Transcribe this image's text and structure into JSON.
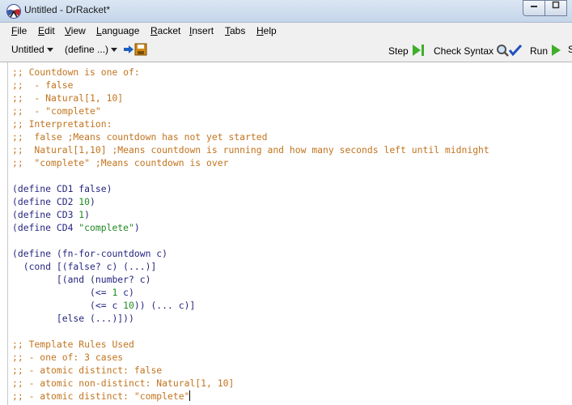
{
  "window": {
    "title": "Untitled - DrRacket*"
  },
  "menu": [
    "File",
    "Edit",
    "View",
    "Language",
    "Racket",
    "Insert",
    "Tabs",
    "Help"
  ],
  "toolbar": {
    "file_label": "Untitled",
    "define_label": "(define ...)",
    "step_label": "Step",
    "check_syntax_label": "Check Syntax",
    "run_label": "Run",
    "stop_label": "S"
  },
  "colors": {
    "comment": "#c2741f",
    "paren": "#262680",
    "literal": "#228b22"
  },
  "code_lines": [
    [
      {
        "t": ";; Countdown is one of:",
        "c": "cm"
      }
    ],
    [
      {
        "t": ";;  - false",
        "c": "cm"
      }
    ],
    [
      {
        "t": ";;  - Natural[1, 10]",
        "c": "cm"
      }
    ],
    [
      {
        "t": ";;  - \"complete\"",
        "c": "cm"
      }
    ],
    [
      {
        "t": ";; Interpretation:",
        "c": "cm"
      }
    ],
    [
      {
        "t": ";;  false ;Means countdown has not yet started",
        "c": "cm"
      }
    ],
    [
      {
        "t": ";;  Natural[1,10] ;Means countdown is running and how many seconds left until midnight",
        "c": "cm"
      }
    ],
    [
      {
        "t": ";;  \"complete\" ;Means countdown is over",
        "c": "cm"
      }
    ],
    [],
    [
      {
        "t": "(define CD1 false)",
        "c": "kw"
      }
    ],
    [
      {
        "t": "(define CD2 ",
        "c": "kw"
      },
      {
        "t": "10",
        "c": "num"
      },
      {
        "t": ")",
        "c": "kw"
      }
    ],
    [
      {
        "t": "(define CD3 ",
        "c": "kw"
      },
      {
        "t": "1",
        "c": "num"
      },
      {
        "t": ")",
        "c": "kw"
      }
    ],
    [
      {
        "t": "(define CD4 ",
        "c": "kw"
      },
      {
        "t": "\"complete\"",
        "c": "str"
      },
      {
        "t": ")",
        "c": "kw"
      }
    ],
    [],
    [
      {
        "t": "(define (fn-for-countdown c)",
        "c": "kw"
      }
    ],
    [
      {
        "t": "  (cond [(false? c) (...)]",
        "c": "kw"
      }
    ],
    [
      {
        "t": "        [(and (number? c)",
        "c": "kw"
      }
    ],
    [
      {
        "t": "              (<= ",
        "c": "kw"
      },
      {
        "t": "1",
        "c": "num"
      },
      {
        "t": " c)",
        "c": "kw"
      }
    ],
    [
      {
        "t": "              (<= c ",
        "c": "kw"
      },
      {
        "t": "10",
        "c": "num"
      },
      {
        "t": ")) (... c)]",
        "c": "kw"
      }
    ],
    [
      {
        "t": "        [else (...)]))",
        "c": "kw"
      }
    ],
    [],
    [
      {
        "t": ";; Template Rules Used",
        "c": "cm"
      }
    ],
    [
      {
        "t": ";; - one of: 3 cases",
        "c": "cm"
      }
    ],
    [
      {
        "t": ";; - atomic distinct: false",
        "c": "cm"
      }
    ],
    [
      {
        "t": ";; - atomic non-distinct: Natural[1, 10]",
        "c": "cm"
      }
    ],
    [
      {
        "t": ";; - atomic distinct: \"complete\"",
        "c": "cm"
      }
    ]
  ]
}
